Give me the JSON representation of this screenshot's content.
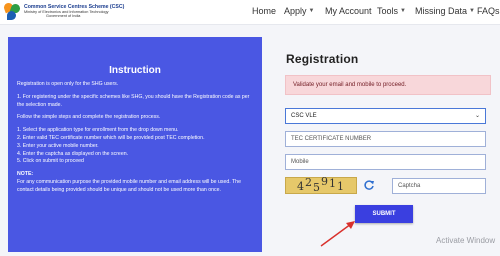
{
  "header": {
    "logo": {
      "line1": "Common Service Centres Scheme (CSC)",
      "line2": "Ministry of Electronics and Information Technology",
      "line3": "Government of India"
    },
    "nav": [
      {
        "label": "Home",
        "has_dropdown": false
      },
      {
        "label": "Apply",
        "has_dropdown": true
      },
      {
        "label": "My Account",
        "has_dropdown": false
      },
      {
        "label": "Tools",
        "has_dropdown": true
      },
      {
        "label": "Missing Data",
        "has_dropdown": true
      },
      {
        "label": "FAQs",
        "has_dropdown": false
      }
    ]
  },
  "instruction": {
    "title": "Instruction",
    "intro": "Registration is open only for the SHG users.",
    "scheme_note": "1. For registering under the specific schemes like SHG, you should have the Registration code as per the selection made.",
    "follow": "Follow the simple steps and complete the registration process.",
    "steps": [
      "1. Select the application type for enrollment from the drop down menu.",
      "2. Enter valid TEC certificate number which will be provided post TEC completion.",
      "3. Enter your active mobile number.",
      "4. Enter the captcha as displayed on the screen.",
      "5. Click on submit to proceed"
    ],
    "note_title": "NOTE:",
    "note_text": "For any communication purpose the provided mobile number and email address will be used. The contact details being provided should be unique and should not be used more than once."
  },
  "form": {
    "title": "Registration",
    "alert": "Validate your email and mobile to proceed.",
    "application_type": "CSC VLE",
    "tec_placeholder": "TEC CERTIFICATE NUMBER",
    "mobile_placeholder": "Mobile",
    "captcha_text": [
      "4",
      "2",
      "5",
      "9",
      "1",
      "1"
    ],
    "captcha_placeholder": "Captcha",
    "submit_label": "SUBMIT"
  },
  "watermark": "Activate Window",
  "colors": {
    "panel": "#4a57e3",
    "submit": "#3a3fe0",
    "alert_bg": "#f8d7da",
    "alert_text": "#721c24",
    "arrow": "#d9302c"
  }
}
